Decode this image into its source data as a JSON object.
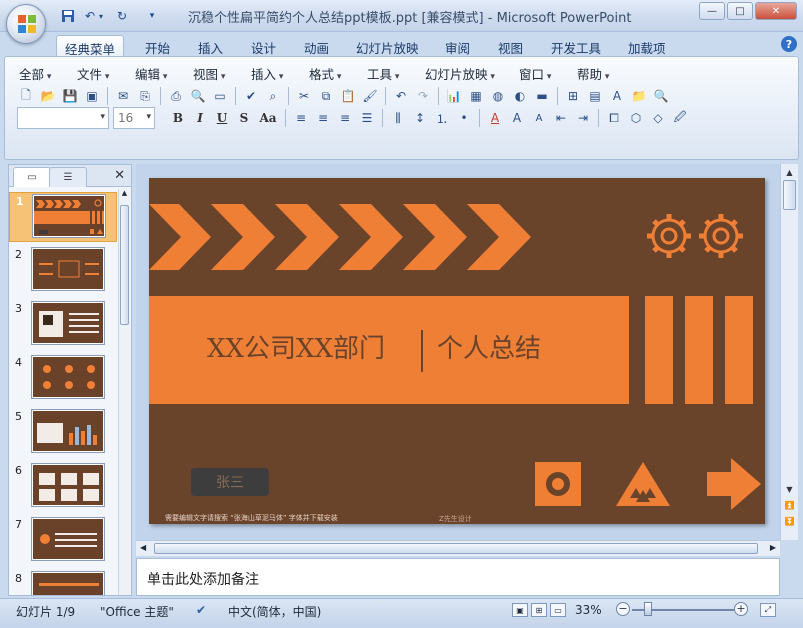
{
  "window": {
    "title": "沉稳个性扁平简约个人总结ppt模板.ppt [兼容模式] - Microsoft PowerPoint",
    "minimize": "—",
    "maximize": "□",
    "close": "✕"
  },
  "ribbon_tabs": [
    "经典菜单",
    "开始",
    "插入",
    "设计",
    "动画",
    "幻灯片放映",
    "审阅",
    "视图",
    "开发工具",
    "加载项"
  ],
  "classic_menu": [
    "全部",
    "文件",
    "编辑",
    "视图",
    "插入",
    "格式",
    "工具",
    "幻灯片放映",
    "窗口",
    "帮助"
  ],
  "toolbar": {
    "font_name_placeholder": "",
    "font_size": "16",
    "format_bold": "B",
    "format_italic": "I",
    "format_underline": "U",
    "format_shadow": "S",
    "format_case": "Aa"
  },
  "slide_thumbnails": [
    "1",
    "2",
    "3",
    "4",
    "5",
    "6",
    "7",
    "8"
  ],
  "slide": {
    "title": "XX公司XX部门",
    "subtitle": "个人总结",
    "name": "张三",
    "footnote": "需要编辑文字请搜索 “张海山草泥马体” 字体并下载安装",
    "credit": "Z先生设计",
    "colors": {
      "background": "#6a432b",
      "accent": "#f07f36"
    }
  },
  "notes_placeholder": "单击此处添加备注",
  "status": {
    "slide_info": "幻灯片 1/9",
    "theme": "\"Office 主题\"",
    "language": "中文(简体，中国)",
    "zoom": "33%"
  }
}
